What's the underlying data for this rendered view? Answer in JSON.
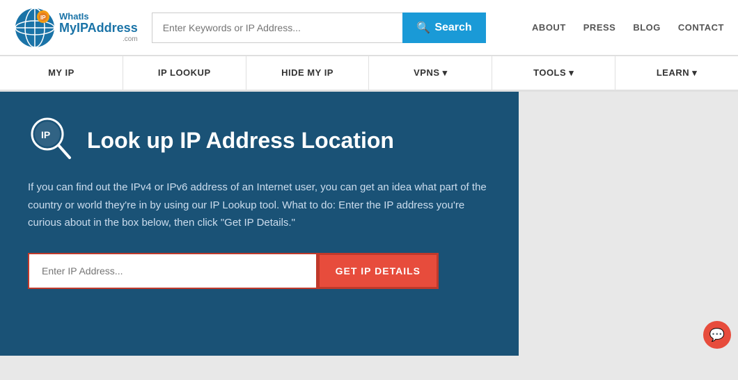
{
  "header": {
    "logo": {
      "what_is": "WhatIs",
      "my_ip": "MyIPAddress",
      "dot_com": ".com"
    },
    "search": {
      "placeholder": "Enter Keywords or IP Address...",
      "button_label": "Search"
    },
    "nav_links": [
      {
        "label": "ABOUT",
        "name": "about-link"
      },
      {
        "label": "PRESS",
        "name": "press-link"
      },
      {
        "label": "BLOG",
        "name": "blog-link"
      },
      {
        "label": "CONTACT",
        "name": "contact-link"
      }
    ]
  },
  "main_nav": [
    {
      "label": "MY IP"
    },
    {
      "label": "IP LOOKUP"
    },
    {
      "label": "HIDE MY IP"
    },
    {
      "label": "VPNS ▾"
    },
    {
      "label": "TOOLS ▾"
    },
    {
      "label": "LEARN ▾"
    }
  ],
  "hero": {
    "title": "Look up IP Address Location",
    "description": "If you can find out the IPv4 or IPv6 address of an Internet user, you can get an idea what part of the country or world they're in by using our IP Lookup tool. What to do: Enter the IP address you're curious about in the box below, then click \"Get IP Details.\"",
    "ip_input_placeholder": "Enter IP Address...",
    "get_ip_button": "GET IP DETAILS"
  },
  "icons": {
    "search": "🔍",
    "magnify_ip": "IP",
    "chat": "💬"
  }
}
